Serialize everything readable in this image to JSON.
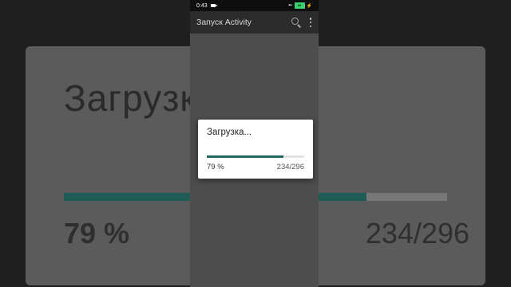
{
  "status_bar": {
    "time": "0:43",
    "battery": "88"
  },
  "app_bar": {
    "title": "Запуск Activity"
  },
  "dialog": {
    "message": "Загрузка...",
    "progress": 0.79,
    "percent_label": "79 %",
    "count_label": "234/296"
  },
  "background": {
    "title": "Загрузк",
    "percent_label": "79 %",
    "count_label": "234/296"
  }
}
